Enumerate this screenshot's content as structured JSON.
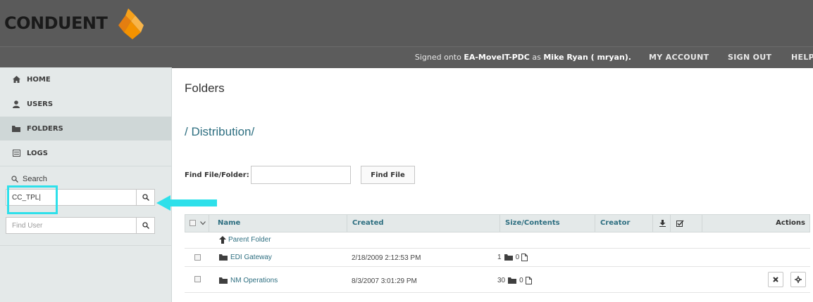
{
  "header": {
    "logo_text": "CONDUENT",
    "signed_prefix": "Signed onto ",
    "host": "EA-MoveIT-PDC",
    "signed_mid": " as ",
    "user": "Mike Ryan ( mryan).",
    "nav": {
      "my_account": "MY ACCOUNT",
      "sign_out": "SIGN OUT",
      "help": "HELP"
    }
  },
  "sidebar": {
    "items": [
      {
        "label": "HOME",
        "icon": "home-icon"
      },
      {
        "label": "USERS",
        "icon": "user-icon"
      },
      {
        "label": "FOLDERS",
        "icon": "folder-icon"
      },
      {
        "label": "LOGS",
        "icon": "list-icon"
      }
    ],
    "search_label": "Search",
    "search_value": "CC_TPL|",
    "find_user_placeholder": "Find User"
  },
  "main": {
    "title": "Folders",
    "path": "/ Distribution/",
    "find_label": "Find File/Folder:",
    "find_button": "Find File",
    "columns": {
      "name": "Name",
      "created": "Created",
      "size": "Size/Contents",
      "creator": "Creator",
      "actions": "Actions"
    },
    "parent_folder": "Parent Folder",
    "rows": [
      {
        "name": "EDI Gateway",
        "created": "2/18/2009 2:12:53 PM",
        "folders": "1",
        "files": "0"
      },
      {
        "name": "NM Operations",
        "created": "8/3/2007 3:01:29 PM",
        "folders": "30",
        "files": "0"
      }
    ]
  },
  "colors": {
    "topbar": "#5a5a5a",
    "sidebar": "#e4e9e9",
    "accent": "#2e6f81",
    "highlight": "#2ee0ea",
    "logo_orange": "#f39200"
  }
}
